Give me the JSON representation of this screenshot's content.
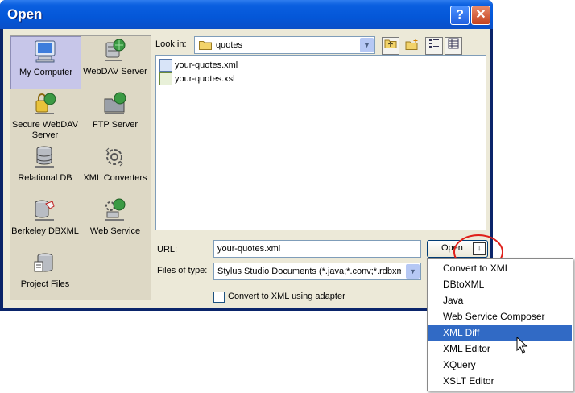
{
  "window": {
    "title": "Open",
    "help_glyph": "?",
    "close_glyph": "✕"
  },
  "places": [
    {
      "label": "My Computer",
      "icon": "computer-icon",
      "selected": true
    },
    {
      "label": "WebDAV Server",
      "icon": "webdav-server-icon",
      "selected": false
    },
    {
      "label": "Secure WebDAV Server",
      "icon": "secure-webdav-icon",
      "selected": false
    },
    {
      "label": "FTP Server",
      "icon": "ftp-server-icon",
      "selected": false
    },
    {
      "label": "Relational DB",
      "icon": "database-icon",
      "selected": false
    },
    {
      "label": "XML Converters",
      "icon": "converters-gear-icon",
      "selected": false
    },
    {
      "label": "Berkeley DBXML",
      "icon": "berkeley-db-icon",
      "selected": false
    },
    {
      "label": "Web Service",
      "icon": "web-service-icon",
      "selected": false
    },
    {
      "label": "Project Files",
      "icon": "project-files-icon",
      "selected": false
    }
  ],
  "look_in": {
    "label": "Look in:",
    "value": "quotes"
  },
  "toolbar": {
    "up_icon": "up-folder-icon",
    "new_folder_icon": "new-folder-icon",
    "list_icon": "list-view-icon",
    "details_icon": "details-view-icon"
  },
  "files": [
    {
      "name": "your-quotes.xml",
      "icon": "xml-file-icon"
    },
    {
      "name": "your-quotes.xsl",
      "icon": "xsl-file-icon"
    }
  ],
  "url": {
    "label": "URL:",
    "value": "your-quotes.xml"
  },
  "files_of_type": {
    "label": "Files of type:",
    "value": "Stylus Studio Documents (*.java;*.conv;*.rdbxml;*"
  },
  "convert": {
    "label": "Convert to XML using adapter",
    "checked": false
  },
  "open_button": {
    "label": "Open",
    "arrow_glyph": "↓"
  },
  "menu": {
    "items": [
      {
        "label": "Convert to XML",
        "highlighted": false
      },
      {
        "label": "DBtoXML",
        "highlighted": false
      },
      {
        "label": "Java",
        "highlighted": false
      },
      {
        "label": "Web Service Composer",
        "highlighted": false
      },
      {
        "label": "XML Diff",
        "highlighted": true
      },
      {
        "label": "XML Editor",
        "highlighted": false
      },
      {
        "label": "XQuery",
        "highlighted": false
      },
      {
        "label": "XSLT Editor",
        "highlighted": false
      }
    ]
  },
  "colors": {
    "titlebar": "#0457d8",
    "face": "#ece9d8",
    "highlight": "#316ac5",
    "annotation_ring": "#e0201a"
  }
}
